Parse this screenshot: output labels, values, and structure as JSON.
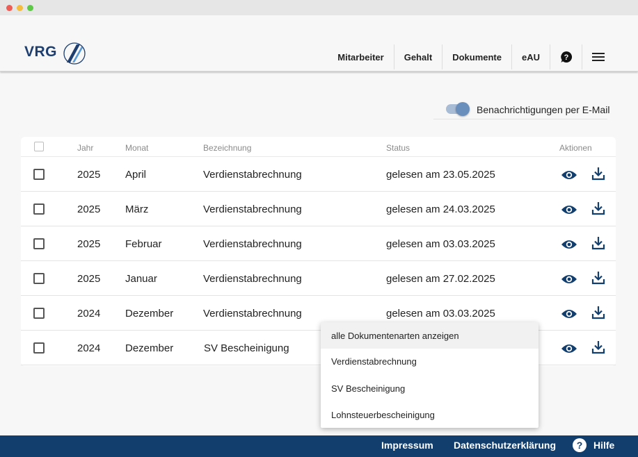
{
  "brand": {
    "logo_text": "VRG",
    "accent": "#123e6e",
    "icon_blue": "#1d3e6e"
  },
  "nav": {
    "items": [
      {
        "label": "Mitarbeiter"
      },
      {
        "label": "Gehalt"
      },
      {
        "label": "Dokumente"
      },
      {
        "label": "eAU"
      }
    ],
    "help_icon": "help-circle-icon",
    "menu_icon": "hamburger-menu-icon"
  },
  "notifications": {
    "label": "Benachrichtigungen per E-Mail",
    "enabled": true
  },
  "table": {
    "headers": {
      "jahr": "Jahr",
      "monat": "Monat",
      "bezeichnung": "Bezeichnung",
      "status": "Status",
      "aktionen": "Aktionen"
    },
    "rows": [
      {
        "jahr": "2025",
        "monat": "April",
        "bezeichnung": "Verdienstabrechnung",
        "status": "gelesen am 23.05.2025"
      },
      {
        "jahr": "2025",
        "monat": "März",
        "bezeichnung": "Verdienstabrechnung",
        "status": "gelesen am 24.03.2025"
      },
      {
        "jahr": "2025",
        "monat": "Februar",
        "bezeichnung": "Verdienstabrechnung",
        "status": "gelesen am 03.03.2025"
      },
      {
        "jahr": "2025",
        "monat": "Januar",
        "bezeichnung": "Verdienstabrechnung",
        "status": "gelesen am 27.02.2025"
      },
      {
        "jahr": "2024",
        "monat": "Dezember",
        "bezeichnung": "Verdienstabrechnung",
        "status": "gelesen am 03.03.2025"
      },
      {
        "jahr": "2024",
        "monat": "Dezember",
        "bezeichnung": "SV Bescheinigung",
        "status": ""
      }
    ],
    "action_icons": [
      "eye-icon",
      "download-icon"
    ]
  },
  "filter_dropdown": {
    "options": [
      {
        "label": "alle Dokumentenarten anzeigen",
        "highlighted": true
      },
      {
        "label": "Verdienstabrechnung"
      },
      {
        "label": "SV Bescheinigung"
      },
      {
        "label": "Lohnsteuerbescheinigung"
      }
    ]
  },
  "footer": {
    "impressum": "Impressum",
    "datenschutz": "Datenschutzerklärung",
    "hilfe": "Hilfe"
  }
}
